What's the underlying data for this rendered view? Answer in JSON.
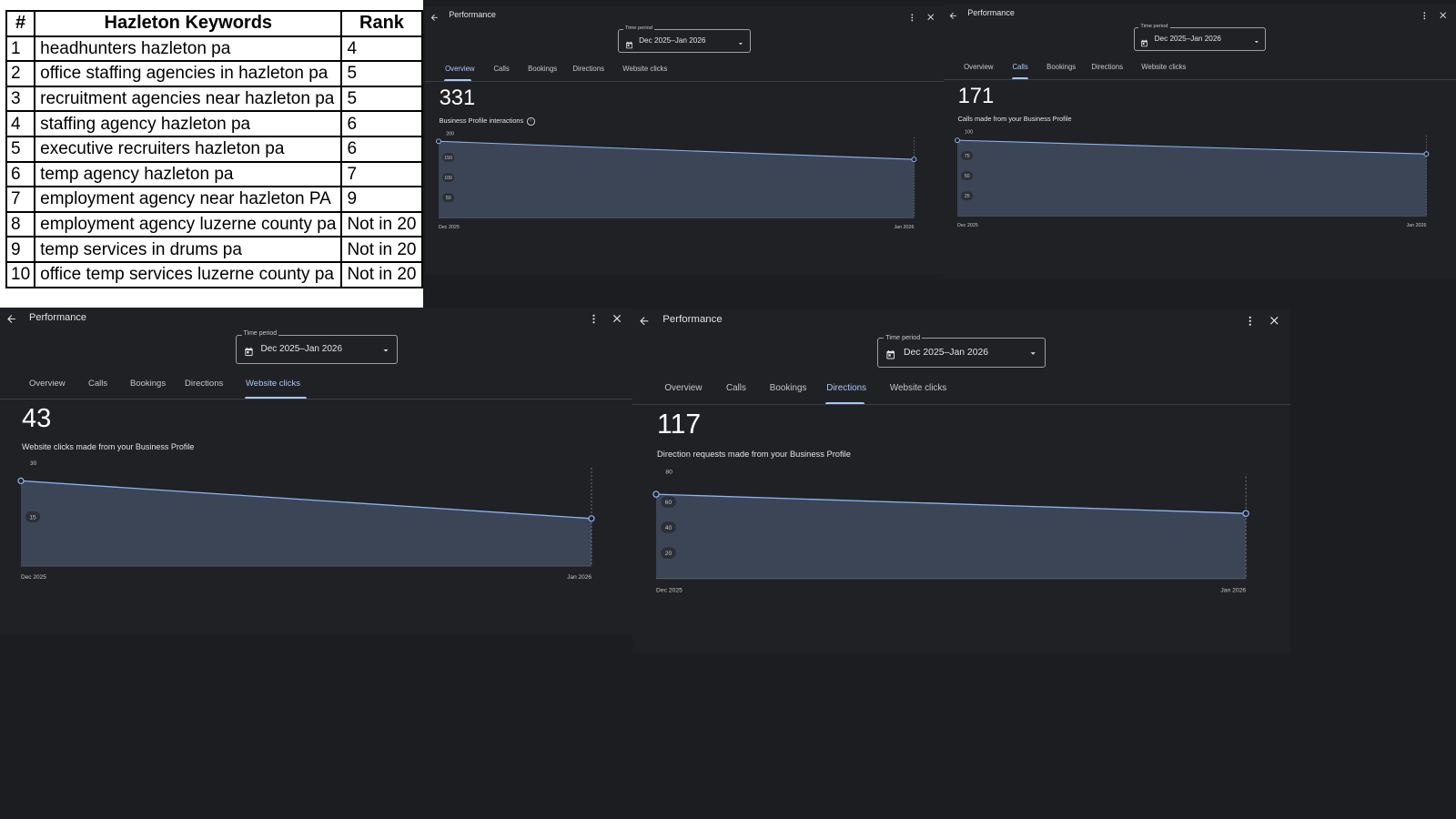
{
  "keyword_table": {
    "headers": [
      "#",
      "Hazleton Keywords",
      "Rank"
    ],
    "rows": [
      [
        "1",
        "headhunters hazleton pa",
        "4"
      ],
      [
        "2",
        "office staffing agencies in hazleton pa",
        "5"
      ],
      [
        "3",
        "recruitment agencies near hazleton pa",
        "5"
      ],
      [
        "4",
        "staffing agency hazleton pa",
        "6"
      ],
      [
        "5",
        "executive recruiters hazleton pa",
        "6"
      ],
      [
        "6",
        "temp agency hazleton pa",
        "7"
      ],
      [
        "7",
        "employment agency near hazleton PA",
        "9"
      ],
      [
        "8",
        "employment agency luzerne county pa",
        "Not in 20"
      ],
      [
        "9",
        "temp services in drums pa",
        "Not in 20"
      ],
      [
        "10",
        "office temp services luzerne county pa",
        "Not in 20"
      ]
    ]
  },
  "colors": {
    "panel_bg": "#202124",
    "page_bg": "#1c1d21",
    "accent": "#a8c7fa",
    "chart_line": "#8ab4f8",
    "chart_fill": "#3b4556"
  },
  "icons": {
    "back": "arrow-left-icon",
    "more": "more-vert-icon",
    "close": "close-icon",
    "calendar": "calendar-icon",
    "dropdown": "dropdown-arrow-icon",
    "info": "info-icon"
  },
  "panels": [
    {
      "title": "Performance",
      "time_period_label": "Time period",
      "time_period_value": "Dec 2025–Jan 2026",
      "tabs": [
        "Overview",
        "Calls",
        "Bookings",
        "Directions",
        "Website clicks"
      ],
      "active_tab": "Overview",
      "total": "331",
      "metric_label": "Business Profile interactions",
      "show_info": true,
      "chart_data": {
        "type": "area",
        "x": [
          "Dec 2025",
          "Jan 2026"
        ],
        "y": [
          190,
          145
        ],
        "x_tick_labels": [
          "Dec 2025",
          "Jan 2026"
        ],
        "y_ticks": [
          200,
          150,
          100,
          50
        ],
        "ylim": [
          0,
          200
        ]
      }
    },
    {
      "title": "Performance",
      "time_period_label": "Time period",
      "time_period_value": "Dec 2025–Jan 2026",
      "tabs": [
        "Overview",
        "Calls",
        "Bookings",
        "Directions",
        "Website clicks"
      ],
      "active_tab": "Calls",
      "total": "171",
      "metric_label": "Calls made from your Business Profile",
      "show_info": false,
      "chart_data": {
        "type": "area",
        "x": [
          "Dec 2025",
          "Jan 2026"
        ],
        "y": [
          94,
          77
        ],
        "x_tick_labels": [
          "Dec 2025",
          "Jan 2026"
        ],
        "y_ticks": [
          100,
          75,
          50,
          25
        ],
        "ylim": [
          0,
          100
        ]
      }
    },
    {
      "title": "Performance",
      "time_period_label": "Time period",
      "time_period_value": "Dec 2025–Jan 2026",
      "tabs": [
        "Overview",
        "Calls",
        "Bookings",
        "Directions",
        "Website clicks"
      ],
      "active_tab": "Website clicks",
      "total": "43",
      "metric_label": "Website clicks made from your Business Profile",
      "show_info": false,
      "chart_data": {
        "type": "area",
        "x": [
          "Dec 2025",
          "Jan 2026"
        ],
        "y": [
          26,
          14.5
        ],
        "x_tick_labels": [
          "Dec 2025",
          "Jan 2026"
        ],
        "y_ticks": [
          30,
          15
        ],
        "ylim": [
          0,
          30
        ]
      }
    },
    {
      "title": "Performance",
      "time_period_label": "Time period",
      "time_period_value": "Dec 2025–Jan 2026",
      "tabs": [
        "Overview",
        "Calls",
        "Bookings",
        "Directions",
        "Website clicks"
      ],
      "active_tab": "Directions",
      "total": "117",
      "metric_label": "Direction requests made from your Business Profile",
      "show_info": false,
      "chart_data": {
        "type": "area",
        "x": [
          "Dec 2025",
          "Jan 2026"
        ],
        "y": [
          66,
          51
        ],
        "x_tick_labels": [
          "Dec 2025",
          "Jan 2026"
        ],
        "y_ticks": [
          80,
          60,
          40,
          20
        ],
        "ylim": [
          0,
          80
        ]
      }
    }
  ]
}
